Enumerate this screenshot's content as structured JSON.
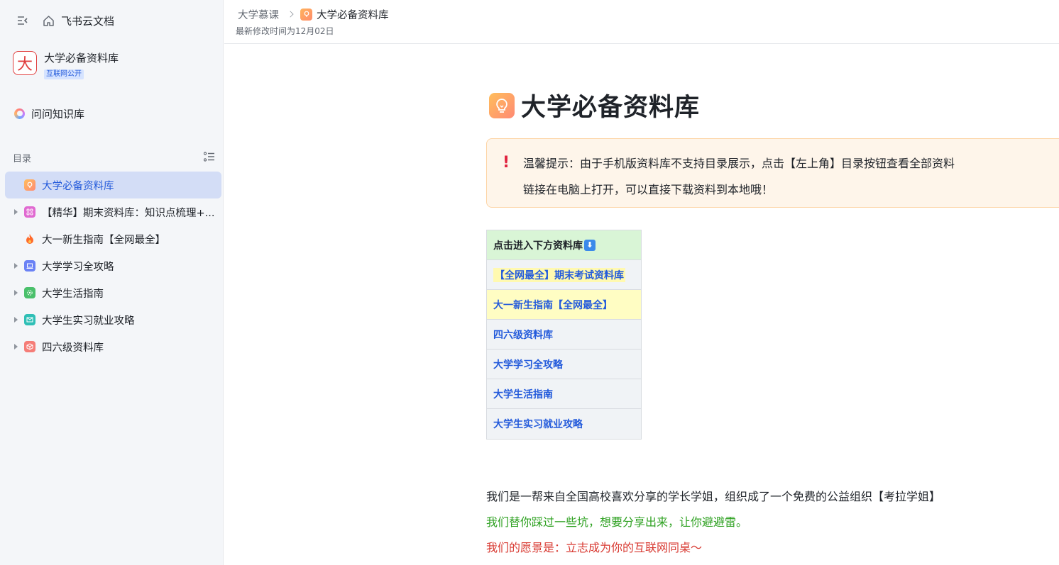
{
  "sidebar": {
    "brand": "飞书云文档",
    "space": {
      "logo_char": "大",
      "title": "大学必备资料库",
      "badge": "互联网公开"
    },
    "ask_label": "问问知识库",
    "toc_label": "目录",
    "items": [
      {
        "label": "大学必备资料库",
        "icon": "bulb-icon",
        "color": "#ffa95c",
        "expandable": false
      },
      {
        "label": "【精华】期末资料库：知识点梳理+...",
        "icon": "grid-icon",
        "color": "#e06ad1",
        "expandable": true
      },
      {
        "label": "大一新生指南【全网最全】",
        "icon": "fire-icon",
        "color": "#ff6a2c",
        "expandable": false
      },
      {
        "label": "大学学习全攻略",
        "icon": "laptop-icon",
        "color": "#6b82f5",
        "expandable": true
      },
      {
        "label": "大学生活指南",
        "icon": "gear-icon",
        "color": "#4ac06b",
        "expandable": true
      },
      {
        "label": "大学生实习就业攻略",
        "icon": "mail-icon",
        "color": "#2fbfb6",
        "expandable": true
      },
      {
        "label": "四六级资料库",
        "icon": "cube-icon",
        "color": "#f57d78",
        "expandable": true
      }
    ]
  },
  "header": {
    "crumb_parent": "大学慕课",
    "crumb_current": "大学必备资料库",
    "modified": "最新修改时间为12月02日"
  },
  "doc": {
    "title": "大学必备资料库",
    "callout": {
      "line1": "温馨提示：由于手机版资料库不支持目录展示，点击【左上角】目录按钮查看全部资料",
      "line2": "链接在电脑上打开，可以直接下载资料到本地哦！"
    },
    "table": {
      "header": "点击进入下方资料库",
      "rows": [
        "【全网最全】期末考试资料库",
        "大一新生指南【全网最全】",
        "四六级资料库",
        "大学学习全攻略",
        "大学生活指南",
        "大学生实习就业攻略"
      ]
    },
    "paragraphs": [
      "我们是一帮来自全国高校喜欢分享的学长学姐，组织成了一个免费的公益组织【考拉学姐】",
      "我们替你踩过一些坑，想要分享出来，让你避避雷。",
      "我们的愿景是：立志成为你的互联网同桌～"
    ]
  },
  "colors": {
    "accent": "#245bdb",
    "green": "#2ea121",
    "red": "#d83931"
  }
}
